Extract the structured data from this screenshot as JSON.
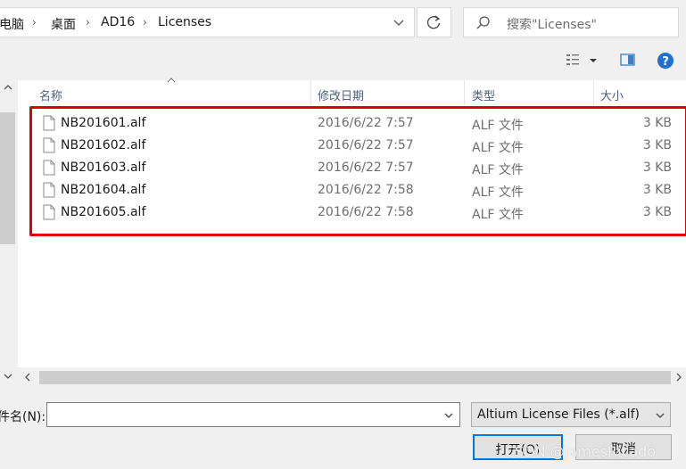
{
  "address": {
    "crumbs": [
      "电脑",
      "桌面",
      "AD16",
      "Licenses"
    ]
  },
  "search": {
    "placeholder": "搜索\"Licenses\""
  },
  "columns": {
    "name": "名称",
    "date": "修改日期",
    "type": "类型",
    "size": "大小"
  },
  "files": [
    {
      "name": "NB201601.alf",
      "date": "2016/6/22 7:57",
      "type": "ALF 文件",
      "size": "3 KB"
    },
    {
      "name": "NB201602.alf",
      "date": "2016/6/22 7:57",
      "type": "ALF 文件",
      "size": "3 KB"
    },
    {
      "name": "NB201603.alf",
      "date": "2016/6/22 7:57",
      "type": "ALF 文件",
      "size": "3 KB"
    },
    {
      "name": "NB201604.alf",
      "date": "2016/6/22 7:58",
      "type": "ALF 文件",
      "size": "3 KB"
    },
    {
      "name": "NB201605.alf",
      "date": "2016/6/22 7:58",
      "type": "ALF 文件",
      "size": "3 KB"
    }
  ],
  "filename": {
    "label": "件名(N):",
    "value": ""
  },
  "filetype": {
    "selected": "Altium License Files (*.alf)"
  },
  "buttons": {
    "open": "打开(O)",
    "cancel": "取消"
  },
  "watermark": "CSDN @JamesRicado",
  "colors": {
    "highlight_box": "#e00000",
    "accent": "#0078d7"
  }
}
